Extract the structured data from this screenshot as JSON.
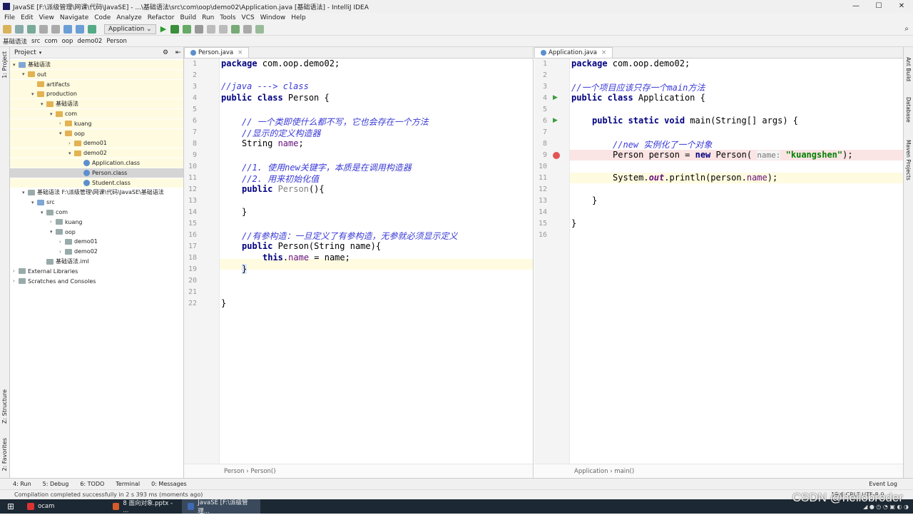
{
  "window": {
    "title": "JavaSE [F:\\派级管理\\网课\\代码\\JavaSE] - ...\\基础语法\\src\\com\\oop\\demo02\\Application.java [基础语法] - IntelliJ IDEA",
    "controls": [
      "—",
      "☐",
      "✕"
    ]
  },
  "menu": [
    "File",
    "Edit",
    "View",
    "Navigate",
    "Code",
    "Analyze",
    "Refactor",
    "Build",
    "Run",
    "Tools",
    "VCS",
    "Window",
    "Help"
  ],
  "toolbar": {
    "run_config": "Application ⌄"
  },
  "breadcrumb": [
    "基础语法",
    "src",
    "com",
    "oop",
    "demo02",
    "Person"
  ],
  "side_strips": {
    "left": [
      "1: Project",
      "Z: Structure",
      "2: Favorites"
    ],
    "right": [
      "Ant Build",
      "Database",
      "Maven Projects"
    ]
  },
  "project": {
    "header": "Project",
    "tree": [
      {
        "label": "基础语法",
        "indent": 0,
        "arrow": "▾",
        "icon": "folder-blue",
        "hl": true
      },
      {
        "label": "out",
        "indent": 1,
        "arrow": "▾",
        "icon": "folder",
        "hl": true
      },
      {
        "label": "artifacts",
        "indent": 2,
        "arrow": "",
        "icon": "folder",
        "hl": true
      },
      {
        "label": "production",
        "indent": 2,
        "arrow": "▾",
        "icon": "folder",
        "hl": true
      },
      {
        "label": "基础语法",
        "indent": 3,
        "arrow": "▾",
        "icon": "folder",
        "hl": true
      },
      {
        "label": "com",
        "indent": 4,
        "arrow": "▾",
        "icon": "folder",
        "hl": true
      },
      {
        "label": "kuang",
        "indent": 5,
        "arrow": "›",
        "icon": "folder",
        "hl": true
      },
      {
        "label": "oop",
        "indent": 5,
        "arrow": "▾",
        "icon": "folder",
        "hl": true
      },
      {
        "label": "demo01",
        "indent": 6,
        "arrow": "›",
        "icon": "folder",
        "hl": true
      },
      {
        "label": "demo02",
        "indent": 6,
        "arrow": "▾",
        "icon": "folder",
        "hl": true
      },
      {
        "label": "Application.class",
        "indent": 7,
        "arrow": "",
        "icon": "class",
        "hl": true
      },
      {
        "label": "Person.class",
        "indent": 7,
        "arrow": "",
        "icon": "class",
        "hl": false,
        "sel": true
      },
      {
        "label": "Student.class",
        "indent": 7,
        "arrow": "",
        "icon": "class",
        "hl": true
      },
      {
        "label": "基础语法 F:\\派级管理\\网课\\代码\\JavaSE\\基础语法",
        "indent": 1,
        "arrow": "▾",
        "icon": "folder-gray",
        "hl": false
      },
      {
        "label": "src",
        "indent": 2,
        "arrow": "▾",
        "icon": "folder-blue",
        "hl": false
      },
      {
        "label": "com",
        "indent": 3,
        "arrow": "▾",
        "icon": "folder-gray",
        "hl": false
      },
      {
        "label": "kuang",
        "indent": 4,
        "arrow": "›",
        "icon": "folder-gray",
        "hl": false
      },
      {
        "label": "oop",
        "indent": 4,
        "arrow": "▾",
        "icon": "folder-gray",
        "hl": false
      },
      {
        "label": "demo01",
        "indent": 5,
        "arrow": "›",
        "icon": "folder-gray",
        "hl": false
      },
      {
        "label": "demo02",
        "indent": 5,
        "arrow": "›",
        "icon": "folder-gray",
        "hl": false
      },
      {
        "label": "基础语法.iml",
        "indent": 3,
        "arrow": "",
        "icon": "folder-gray",
        "hl": false
      },
      {
        "label": "External Libraries",
        "indent": 0,
        "arrow": "›",
        "icon": "folder-gray",
        "hl": false
      },
      {
        "label": "Scratches and Consoles",
        "indent": 0,
        "arrow": "›",
        "icon": "folder-gray",
        "hl": false
      }
    ]
  },
  "left_editor": {
    "tab": "Person.java",
    "footer": "Person  ›  Person()",
    "line_numbers": [
      "1",
      "2",
      "3",
      "4",
      "5",
      "6",
      "7",
      "8",
      "9",
      "10",
      "11",
      "12",
      "13",
      "14",
      "15",
      "16",
      "17",
      "18",
      "19",
      "20",
      "21",
      "22"
    ]
  },
  "right_editor": {
    "tab": "Application.java",
    "footer": "Application  ›  main()",
    "line_numbers": [
      "1",
      "2",
      "3",
      "4",
      "5",
      "6",
      "7",
      "8",
      "9",
      "10",
      "11",
      "12",
      "13",
      "14",
      "15",
      "16"
    ]
  },
  "code_left": {
    "l1_kw": "package",
    "l1_rest": " com.oop.demo02;",
    "l3": "//java ---> class",
    "l4_kw": "public class",
    "l4_rest": " Person {",
    "l6": "// 一个类即使什么都不写，它也会存在一个方法",
    "l7": "//显示的定义构造器",
    "l8_a": "String ",
    "l8_b": "name",
    "l8_c": ";",
    "l10": "//1. 使用new关键字，本质是在调用构造器",
    "l11": "//2. 用来初始化值",
    "l12_kw": "public",
    "l12_b": " Person",
    "l12_c": "(){",
    "l14": "}",
    "l16": "//有参构造：一旦定义了有参构造，无参就必须显示定义",
    "l17_kw": "public",
    "l17_rest": " Person(String name){",
    "l18_kw": "this",
    "l18_b": ".",
    "l18_c": "name",
    "l18_d": " = name;",
    "l19": "}",
    "l22": "}"
  },
  "code_right": {
    "l1_kw": "package",
    "l1_rest": " com.oop.demo02;",
    "l3": "//一个项目应该只存一个main方法",
    "l4_kw": "public class",
    "l4_rest": " Application {",
    "l6_kw": "public static void",
    "l6_rest": " main(String[] args) {",
    "l8": "//new 实例化了一个对象",
    "l9_a": "Person person = ",
    "l9_kw": "new",
    "l9_b": " Person( ",
    "l9_hint": "name:",
    "l9_str": " \"kuangshen\"",
    "l9_c": ");",
    "l11_a": "System.",
    "l11_out": "out",
    "l11_b": ".println(person.",
    "l11_name": "name",
    "l11_c": ");",
    "l13": "}",
    "l15": "}"
  },
  "toolwindows": [
    "4: Run",
    "5: Debug",
    "6: TODO",
    "Terminal",
    "0: Messages"
  ],
  "event_log": "Event Log",
  "status": {
    "message": "Compilation completed successfully in 2 s 393 ms (moments ago)",
    "position": "19:6  CRLF  UTF-8  ⚲"
  },
  "taskbar": {
    "start": "⊞",
    "items": [
      {
        "label": "ocam",
        "color": "#d33"
      },
      {
        "label": "8  面向对象.pptx - ...",
        "color": "#d55c2a"
      },
      {
        "label": "JavaSE [F:\\派级管理...",
        "color": "#3e6ab3"
      }
    ],
    "tray": "◢  ●  ◷  ◔  ▣  ◐  ◑"
  },
  "watermark": "CSDN @hellobroder",
  "colors": {
    "keyword": "#000080",
    "comment": "#3a3ad6",
    "string": "#008000",
    "field": "#660e7a",
    "highlight": "#fffbe0",
    "breakpoint": "#e15555"
  }
}
